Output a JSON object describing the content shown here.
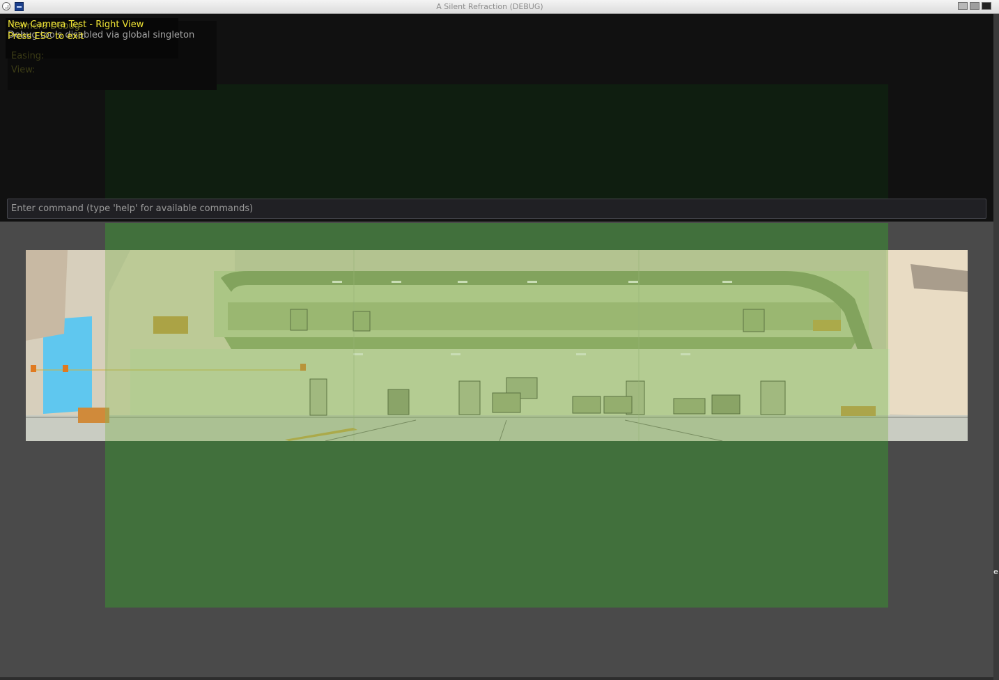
{
  "window": {
    "title": "A Silent Refraction (DEBUG)",
    "icons": [
      "window-menu-icon",
      "app-icon",
      "minimize-icon",
      "maximize-icon",
      "close-icon"
    ]
  },
  "debug": {
    "heading_ghost": "Camera Debug",
    "easing_label": "Easing:",
    "view_label": "View:",
    "status_line": "Debug tools disabled via global singleton",
    "test_title": "New Camera Test - Right View",
    "exit_hint": "Press ESC to exit"
  },
  "console": {
    "placeholder": "Enter command (type 'help' for available commands)",
    "value": ""
  },
  "edge": {
    "glyph": "e"
  },
  "colors": {
    "camera_zone": "#41703c",
    "highlight_text": "#f2e635",
    "background": "#4a4a4a"
  }
}
